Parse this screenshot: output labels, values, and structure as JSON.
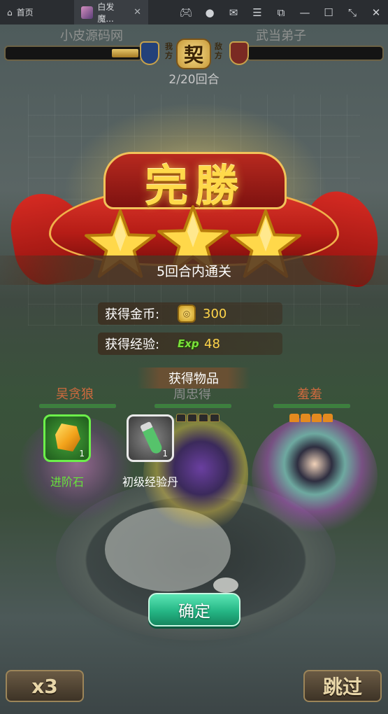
{
  "chrome": {
    "home_tab": "首页",
    "game_tab": "白发魔...",
    "icons": [
      "gamepad-icon",
      "account-icon",
      "mail-icon",
      "menu-icon",
      "popout-icon",
      "minimize-icon",
      "maximize-icon",
      "collapse-icon",
      "close-icon"
    ]
  },
  "battle": {
    "team_left": "小皮源码网",
    "team_right": "武当弟子",
    "side_left": "我方",
    "side_right": "敌方",
    "badge": "契",
    "round": "2/20回合",
    "left_hp_fraction": 0.2
  },
  "result": {
    "title": "完勝",
    "stars": 3,
    "condition": "5回合内通关",
    "gold_label": "获得金币:",
    "gold_value": "300",
    "exp_label": "获得经验:",
    "exp_icon_text": "Exp",
    "exp_value": "48",
    "items_header": "获得物品"
  },
  "heroes": [
    {
      "name": "吴贪狼"
    },
    {
      "name": "周忠得"
    },
    {
      "name": "羞羞"
    }
  ],
  "items": [
    {
      "name": "进阶石",
      "count": "1",
      "quality_color": "#6cf04a"
    },
    {
      "name": "初级经验丹",
      "count": "1",
      "quality_color": "#e9e9e9"
    }
  ],
  "buttons": {
    "confirm": "确定",
    "speed": "x3",
    "skip": "跳过"
  },
  "colors": {
    "star": "#ffd84a",
    "banner_red": "#c8231a",
    "confirm_green": "#25b685",
    "gold_text": "#ffd54a"
  }
}
